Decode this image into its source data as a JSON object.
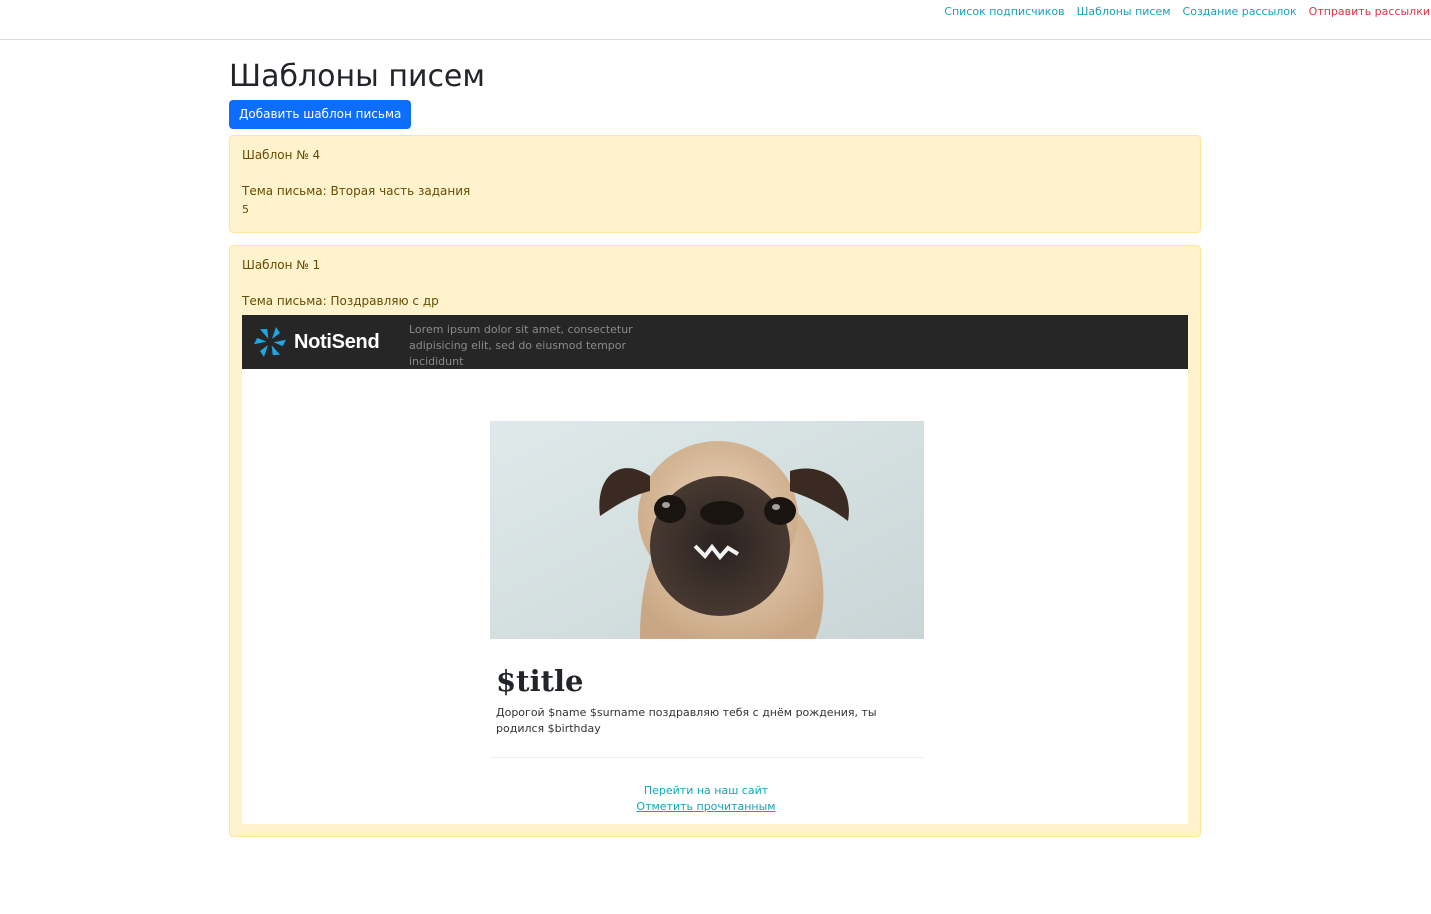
{
  "nav": {
    "links": [
      {
        "label": "Список подписчиков",
        "style": "info"
      },
      {
        "label": "Шаблоны писем",
        "style": "info"
      },
      {
        "label": "Создание рассылок",
        "style": "info"
      },
      {
        "label": "Отправить рассылки",
        "style": "danger"
      }
    ]
  },
  "page": {
    "title": "Шаблоны писем",
    "add_button_label": "Добавить шаблон письма"
  },
  "templates": [
    {
      "title": "Шаблон № 4",
      "subject": "Тема письма: Вторая часть задания",
      "body": "5"
    },
    {
      "title": "Шаблон № 1",
      "subject": "Тема письма: Поздравляю с др",
      "email": {
        "logo_text": "NotiSend",
        "header_text": "Lorem ipsum dolor sit amet, consectetur adipisicing elit, sed do eiusmod tempor incididunt",
        "image": "pug-photo",
        "title": "$title",
        "text": "Дорогой $name $surname поздравляю тебя с днём рождения, ты родился $birthday",
        "link_site": "Перейти на наш сайт",
        "link_mark_read": "Отметить прочитанным"
      }
    }
  ],
  "colors": {
    "primary": "#0d6efd",
    "info": "#17a2b8",
    "danger": "#dc3545",
    "card_bg": "#fff3cd",
    "card_border": "#ffe69c",
    "card_text": "#664d03",
    "email_header_bg": "#262626",
    "logo_accent": "#1ea7e4"
  }
}
